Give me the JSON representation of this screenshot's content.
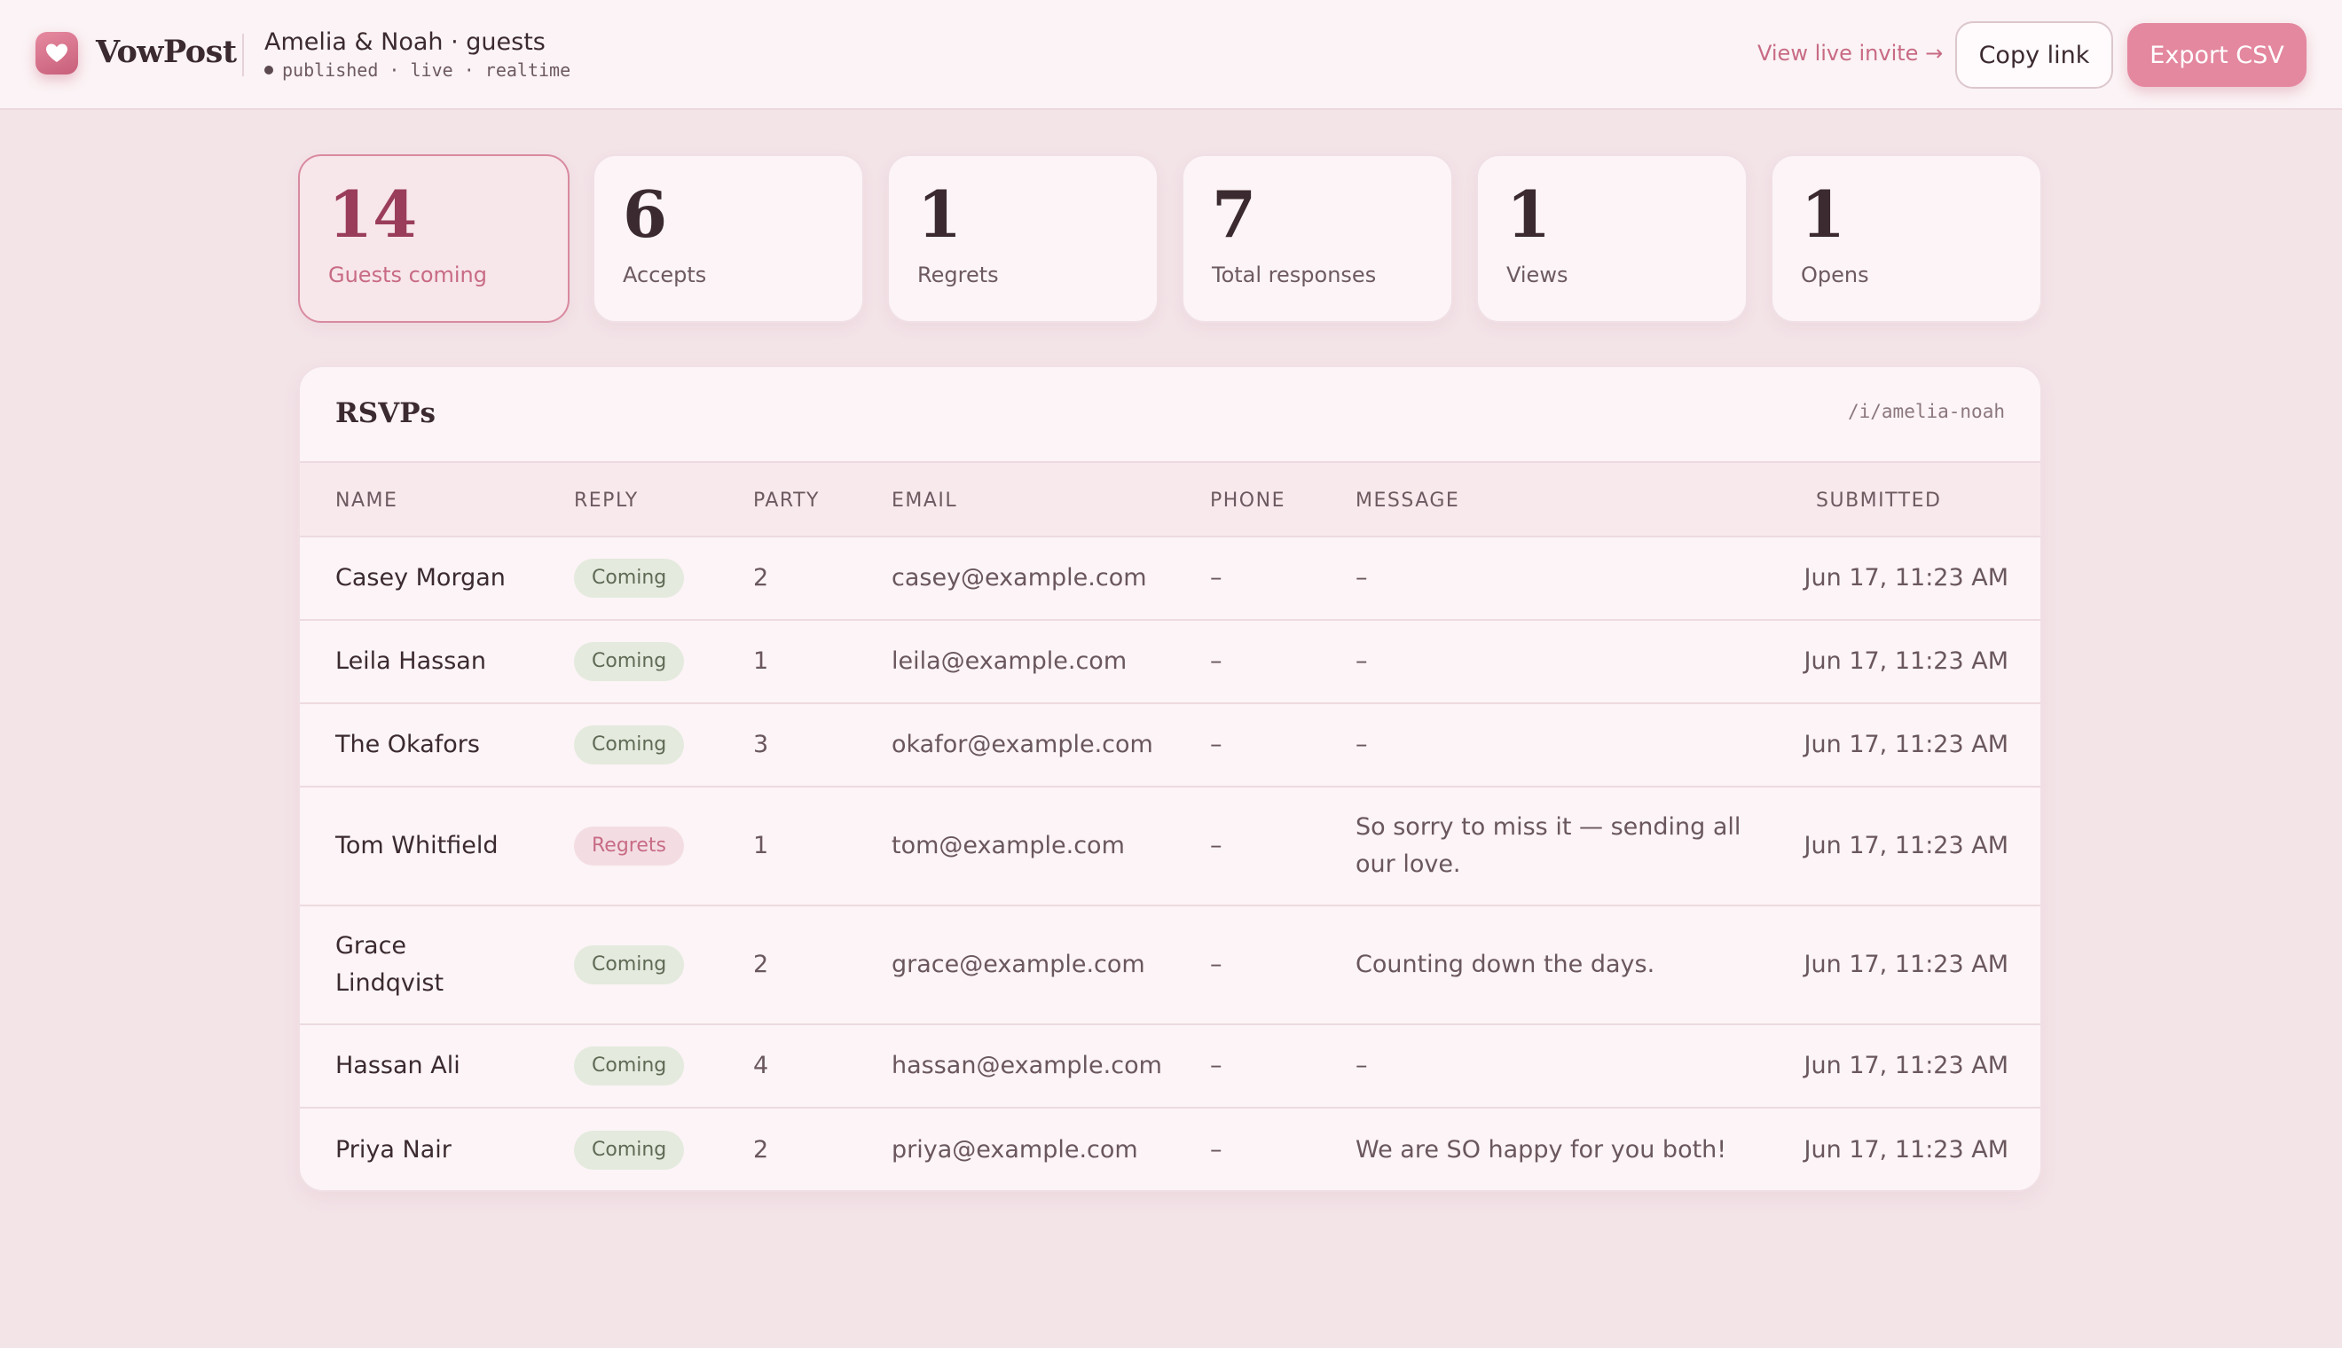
{
  "header": {
    "brand": "VowPost",
    "logo_icon": "heart-icon",
    "event_title": "Amelia & Noah · guests",
    "event_status": "published · live · realtime",
    "view_live_label": "View live invite →",
    "copy_link_label": "Copy link",
    "export_label": "Export CSV"
  },
  "stats": [
    {
      "value": "14",
      "label": "Guests coming"
    },
    {
      "value": "6",
      "label": "Accepts"
    },
    {
      "value": "1",
      "label": "Regrets"
    },
    {
      "value": "7",
      "label": "Total responses"
    },
    {
      "value": "1",
      "label": "Views"
    },
    {
      "value": "1",
      "label": "Opens"
    }
  ],
  "rsvps": {
    "title": "RSVPs",
    "slug": "/i/amelia-noah",
    "columns": [
      "NAME",
      "REPLY",
      "PARTY",
      "EMAIL",
      "PHONE",
      "MESSAGE",
      "SUBMITTED"
    ],
    "rows": [
      {
        "name": "Casey Morgan",
        "reply": "Coming",
        "party": "2",
        "email": "casey@example.com",
        "phone": "–",
        "message": "–",
        "submitted": "Jun 17, 11:23 AM"
      },
      {
        "name": "Leila Hassan",
        "reply": "Coming",
        "party": "1",
        "email": "leila@example.com",
        "phone": "–",
        "message": "–",
        "submitted": "Jun 17, 11:23 AM"
      },
      {
        "name": "The Okafors",
        "reply": "Coming",
        "party": "3",
        "email": "okafor@example.com",
        "phone": "–",
        "message": "–",
        "submitted": "Jun 17, 11:23 AM"
      },
      {
        "name": "Tom Whitfield",
        "reply": "Regrets",
        "party": "1",
        "email": "tom@example.com",
        "phone": "–",
        "message": "So sorry to miss it — sending all our love.",
        "submitted": "Jun 17, 11:23 AM"
      },
      {
        "name": "Grace Lindqvist",
        "reply": "Coming",
        "party": "2",
        "email": "grace@example.com",
        "phone": "–",
        "message": "Counting down the days.",
        "submitted": "Jun 17, 11:23 AM"
      },
      {
        "name": "Hassan Ali",
        "reply": "Coming",
        "party": "4",
        "email": "hassan@example.com",
        "phone": "–",
        "message": "–",
        "submitted": "Jun 17, 11:23 AM"
      },
      {
        "name": "Priya Nair",
        "reply": "Coming",
        "party": "2",
        "email": "priya@example.com",
        "phone": "–",
        "message": "We are SO happy for you both!",
        "submitted": "Jun 17, 11:23 AM"
      }
    ]
  }
}
